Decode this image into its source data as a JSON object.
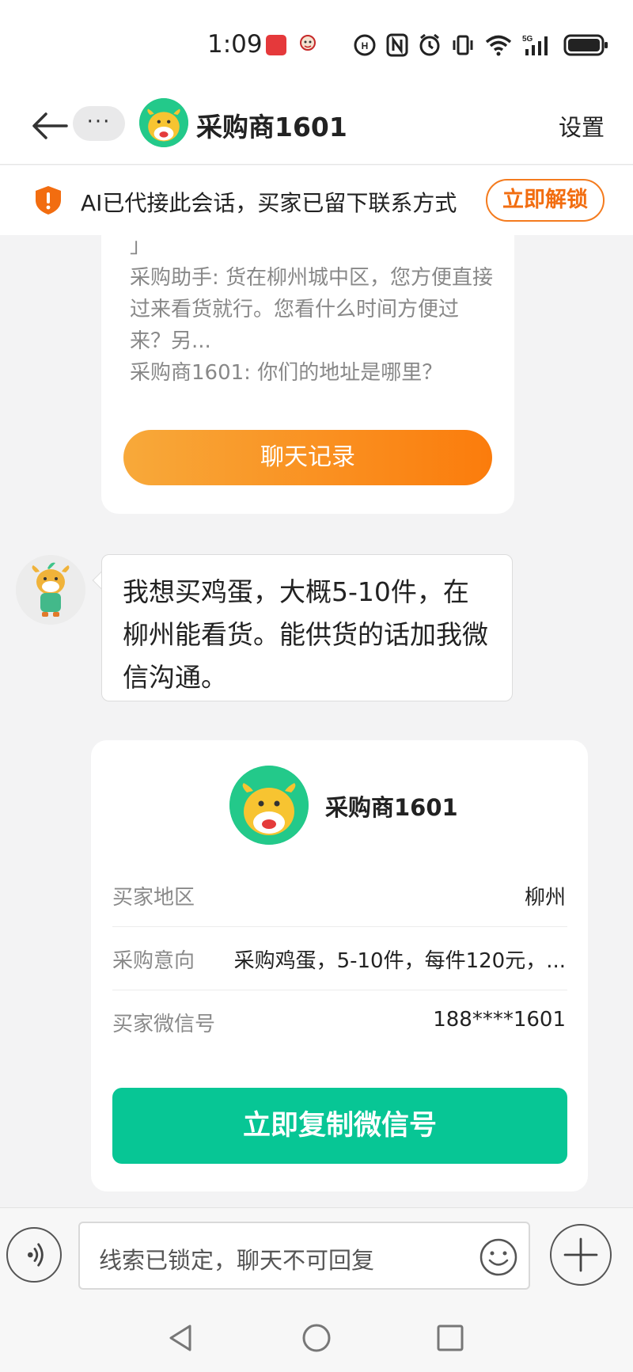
{
  "status_bar": {
    "time": "1:09",
    "icons": [
      "nfc-icon",
      "alarm-icon",
      "vibrate-icon",
      "wifi-icon",
      "5g-signal-icon",
      "battery-icon"
    ]
  },
  "header": {
    "title": "采购商1601",
    "more_label": "···",
    "settings_label": "设置"
  },
  "banner": {
    "text": "AI已代接此会话，买家已留下联系方式",
    "unlock_label": "立即解锁",
    "accent_color": "#f26d10"
  },
  "chat_record": {
    "lines": [
      "」",
      "采购助手: 货在柳州城中区，您方便直接过来看货就行。您看什么时间方便过来？另...",
      "采购商1601: 你们的地址是哪里？"
    ],
    "button_label": "聊天记录"
  },
  "message": {
    "text": "我想买鸡蛋，大概5-10件，在柳州能看货。能供货的话加我微信沟通。"
  },
  "contact_card": {
    "name": "采购商1601",
    "rows": [
      {
        "label": "买家地区",
        "value": "柳州"
      },
      {
        "label": "采购意向",
        "value": "采购鸡蛋，5-10件，每件120元，..."
      },
      {
        "label": "买家微信号",
        "value": "188****1601"
      }
    ],
    "copy_label": "立即复制微信号",
    "button_color": "#07c695"
  },
  "input_bar": {
    "placeholder": "线索已锁定，聊天不可回复"
  }
}
